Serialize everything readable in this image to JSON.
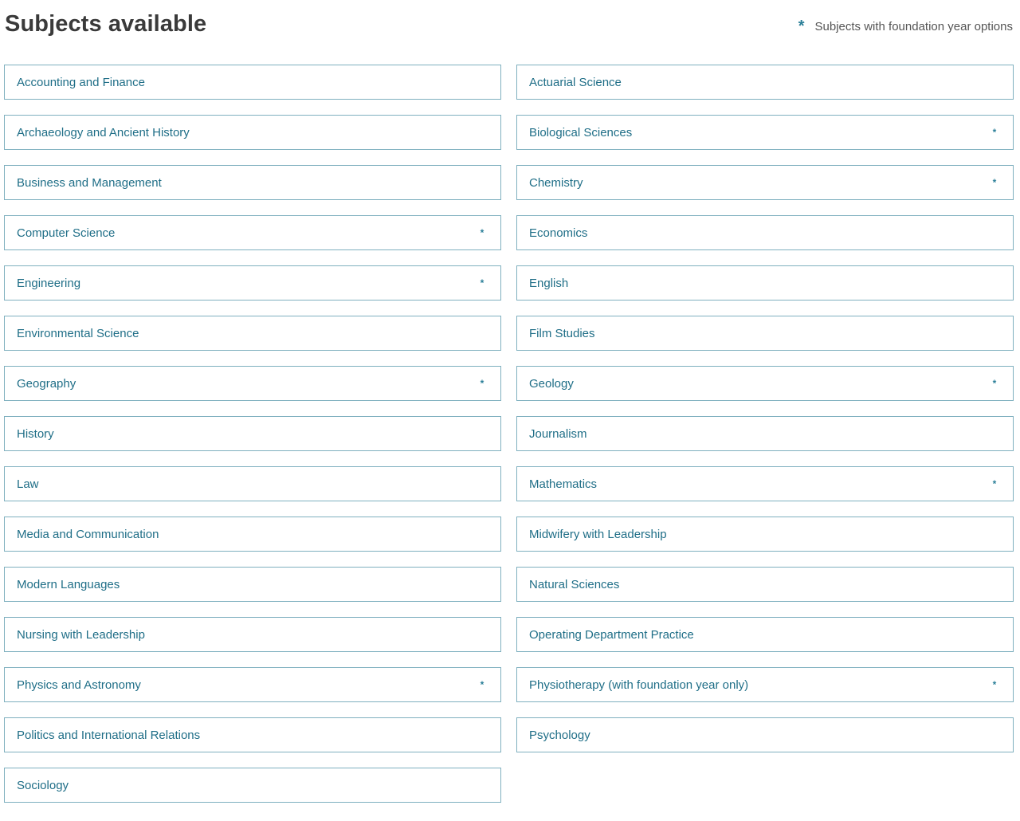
{
  "header": {
    "title": "Subjects available",
    "legend_symbol": "*",
    "legend_text": "Subjects with foundation year options"
  },
  "subjects": [
    {
      "label": "Accounting and Finance",
      "foundation": false
    },
    {
      "label": "Actuarial Science",
      "foundation": false
    },
    {
      "label": "Archaeology and Ancient History",
      "foundation": false
    },
    {
      "label": "Biological Sciences",
      "foundation": true
    },
    {
      "label": "Business and Management",
      "foundation": false
    },
    {
      "label": "Chemistry",
      "foundation": true
    },
    {
      "label": "Computer Science",
      "foundation": true
    },
    {
      "label": "Economics",
      "foundation": false
    },
    {
      "label": "Engineering",
      "foundation": true
    },
    {
      "label": "English",
      "foundation": false
    },
    {
      "label": "Environmental Science",
      "foundation": false
    },
    {
      "label": "Film Studies",
      "foundation": false
    },
    {
      "label": "Geography",
      "foundation": true
    },
    {
      "label": "Geology",
      "foundation": true
    },
    {
      "label": "History",
      "foundation": false
    },
    {
      "label": "Journalism",
      "foundation": false
    },
    {
      "label": "Law",
      "foundation": false
    },
    {
      "label": "Mathematics",
      "foundation": true
    },
    {
      "label": "Media and Communication",
      "foundation": false
    },
    {
      "label": "Midwifery with Leadership",
      "foundation": false
    },
    {
      "label": "Modern Languages",
      "foundation": false
    },
    {
      "label": "Natural Sciences",
      "foundation": false
    },
    {
      "label": "Nursing with Leadership",
      "foundation": false
    },
    {
      "label": "Operating Department Practice",
      "foundation": false
    },
    {
      "label": "Physics and Astronomy",
      "foundation": true
    },
    {
      "label": "Physiotherapy (with foundation year only)",
      "foundation": true
    },
    {
      "label": "Politics and International Relations",
      "foundation": false
    },
    {
      "label": "Psychology",
      "foundation": false
    },
    {
      "label": "Sociology",
      "foundation": false
    }
  ],
  "colors": {
    "title": "#3a3a3a",
    "accent": "#1f6e87",
    "border": "#7fb0bf",
    "legend_text": "#555555"
  }
}
